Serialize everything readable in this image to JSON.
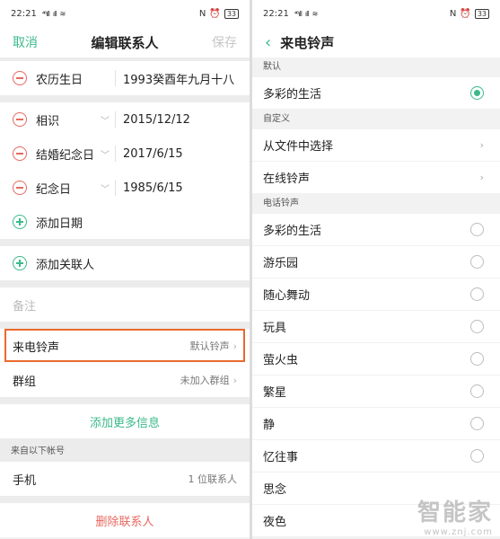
{
  "status_bar": {
    "time": "22:21",
    "signal1": "⁴⁶ıll",
    "signal2": "ıll",
    "net_speed": "N",
    "battery": "33"
  },
  "left": {
    "nav": {
      "cancel": "取消",
      "title": "编辑联系人",
      "save": "保存"
    },
    "fields": [
      {
        "label": "农历生日",
        "value": "1993癸酉年九月十八"
      },
      {
        "label": "相识",
        "value": "2015/12/12"
      },
      {
        "label": "结婚纪念日",
        "value": "2017/6/15"
      },
      {
        "label": "纪念日",
        "value": "1985/6/15"
      }
    ],
    "add_date": "添加日期",
    "add_related": "添加关联人",
    "notes_placeholder": "备注",
    "ringtone": {
      "label": "来电铃声",
      "value": "默认铃声"
    },
    "group": {
      "label": "群组",
      "value": "未加入群组"
    },
    "add_more": "添加更多信息",
    "account_header": "来自以下帐号",
    "account": {
      "label": "手机",
      "value": "1 位联系人"
    },
    "delete": "删除联系人"
  },
  "right": {
    "nav": {
      "title": "来电铃声"
    },
    "default_header": "默认",
    "default_item": "多彩的生活",
    "custom_header": "自定义",
    "custom_items": [
      "从文件中选择",
      "在线铃声"
    ],
    "phone_header": "电话铃声",
    "ringtones": [
      "多彩的生活",
      "游乐园",
      "随心舞动",
      "玩具",
      "萤火虫",
      "繁星",
      "静",
      "忆往事",
      "思念",
      "夜色"
    ]
  },
  "watermark": {
    "brand": "智能家",
    "url": "www.znj.com"
  },
  "colors": {
    "accent": "#3bb98a",
    "danger": "#e8685f",
    "highlight": "#e8692d"
  }
}
